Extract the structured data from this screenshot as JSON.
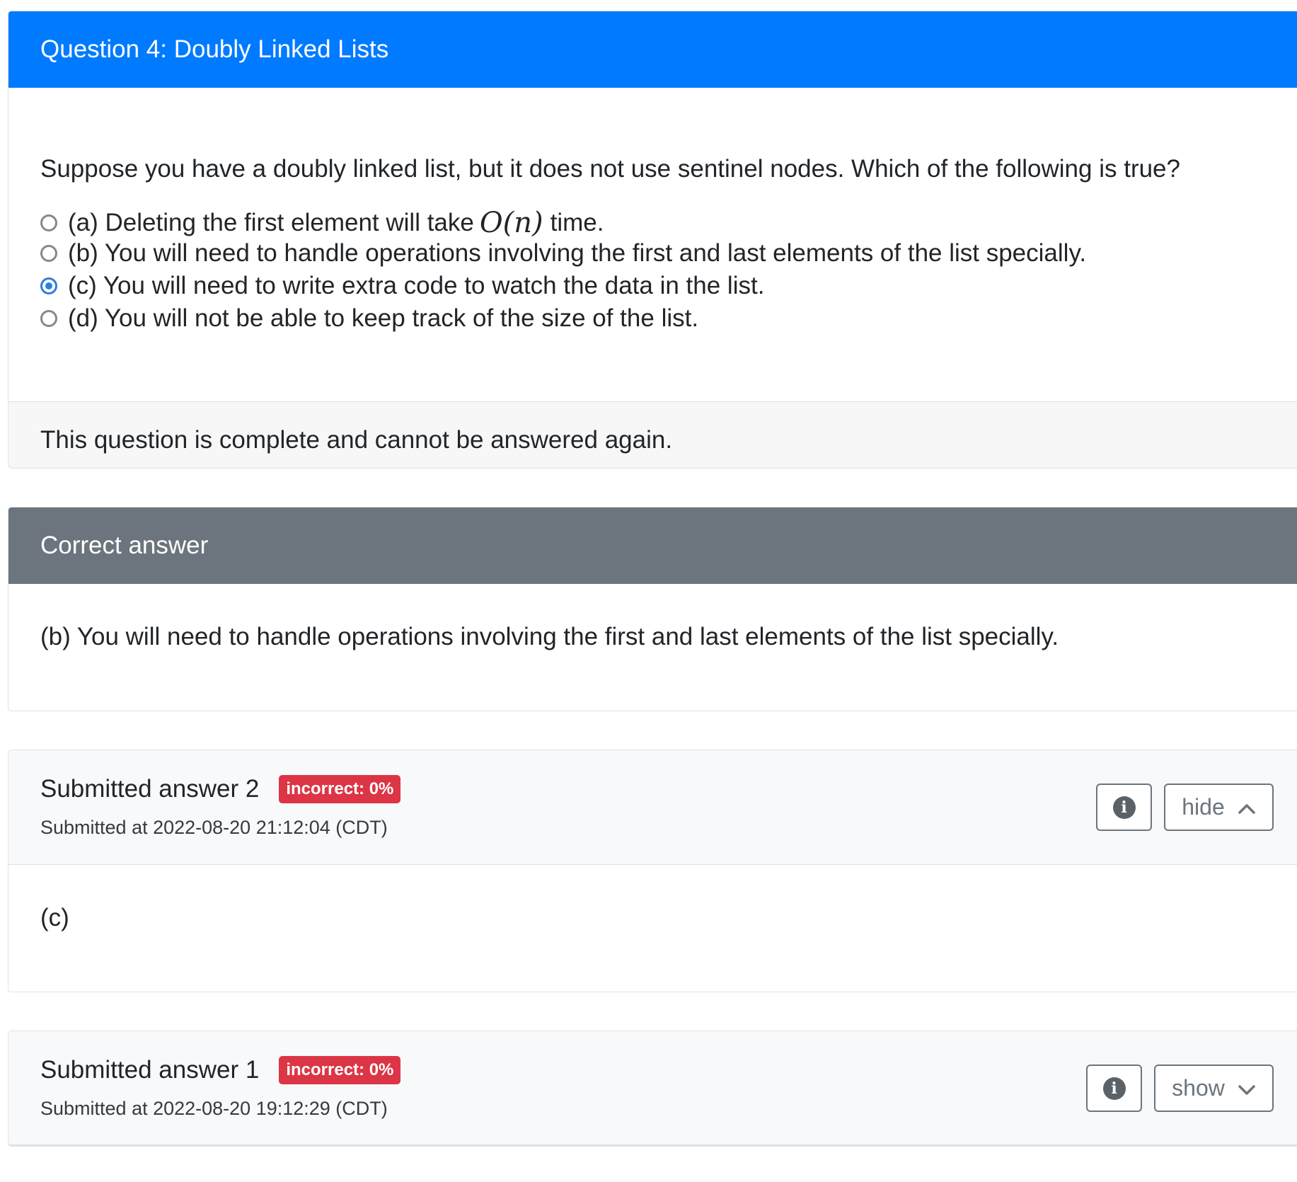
{
  "question": {
    "title": "Question 4: Doubly Linked Lists",
    "prompt": "Suppose you have a doubly linked list, but it does not use sentinel nodes. Which of the following is true?",
    "options": [
      {
        "pre": "(a) Deleting the first element will take",
        "math": "O(n)",
        "post": "time.",
        "checked": false
      },
      {
        "text": "(b) You will need to handle operations involving the first and last elements of the list specially.",
        "checked": false
      },
      {
        "text": "(c) You will need to write extra code to watch the data in the list.",
        "checked": true
      },
      {
        "text": "(d) You will not be able to keep track of the size of the list.",
        "checked": false
      }
    ],
    "footer": "This question is complete and cannot be answered again."
  },
  "correct_answer": {
    "title": "Correct answer",
    "text": "(b) You will need to handle operations involving the first and last elements of the list specially."
  },
  "submissions": [
    {
      "title": "Submitted answer 2",
      "badge": "incorrect: 0%",
      "time": "Submitted at 2022-08-20 21:12:04 (CDT)",
      "toggle_label": "hide",
      "answer": "(c)"
    },
    {
      "title": "Submitted answer 1",
      "badge": "incorrect: 0%",
      "time": "Submitted at 2022-08-20 19:12:29 (CDT)",
      "toggle_label": "show"
    }
  ],
  "icons": {
    "info": "i",
    "chevron_up": "chevron-up-icon",
    "chevron_down": "chevron-down-icon"
  },
  "colors": {
    "primary": "#007bff",
    "secondary": "#6c757d",
    "danger": "#dc3545",
    "radio_checked": "#2f7de1"
  }
}
